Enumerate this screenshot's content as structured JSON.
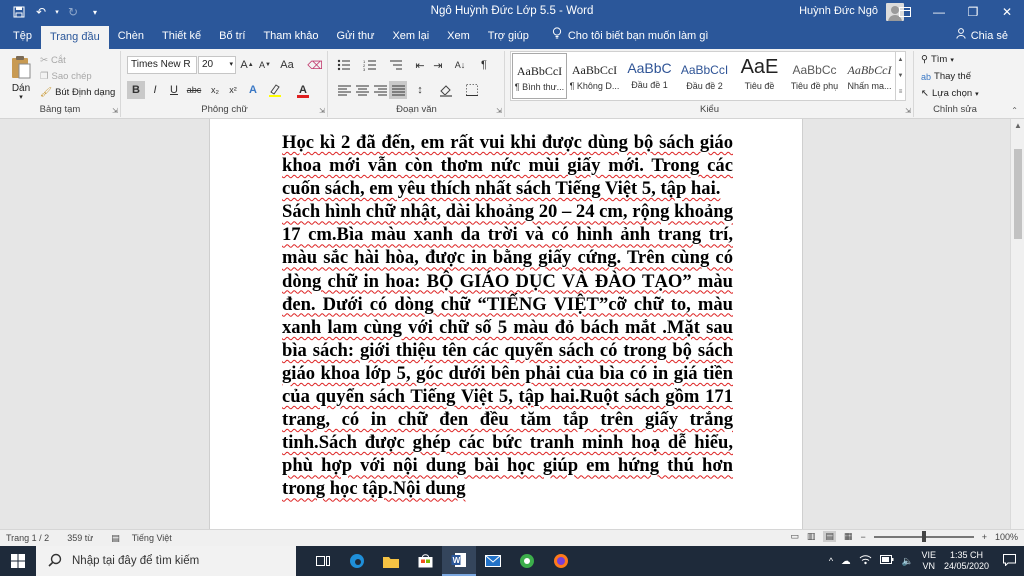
{
  "window": {
    "title": "Ngô Huỳnh Đức Lớp 5.5  -  Word",
    "user_name": "Huỳnh Đức Ngô",
    "minimize": "—",
    "restore": "❐",
    "close": "✕"
  },
  "tabs": [
    "Tệp",
    "Trang đầu",
    "Chèn",
    "Thiết kế",
    "Bố trí",
    "Tham khảo",
    "Gửi thư",
    "Xem lại",
    "Xem",
    "Trợ giúp"
  ],
  "tell_me": "Cho tôi biết bạn muốn làm gì",
  "share": "Chia sẻ",
  "clipboard": {
    "paste": "Dán",
    "cut": "Cắt",
    "copy": "Sao chép",
    "format_painter": "Bút Định dạng",
    "label": "Bảng tạm"
  },
  "font": {
    "name": "Times New R",
    "size": "20",
    "label": "Phông chữ",
    "bold": "B",
    "italic": "I",
    "underline": "U",
    "strike": "abc",
    "sub": "x₂",
    "sup": "x²",
    "grow": "A",
    "shrink": "A",
    "case": "Aa",
    "color_a": "A"
  },
  "paragraph": {
    "label": "Đoạn văn"
  },
  "styles": {
    "label": "Kiểu",
    "items": [
      {
        "sample": "AaBbCcI",
        "name": "¶ Bình thư..."
      },
      {
        "sample": "AaBbCcI",
        "name": "¶ Không D..."
      },
      {
        "sample": "AaBbC",
        "name": "Đầu đề 1"
      },
      {
        "sample": "AaBbCcI",
        "name": "Đầu đề 2"
      },
      {
        "sample": "AaE",
        "name": "Tiêu đề"
      },
      {
        "sample": "AaBbCc",
        "name": "Tiêu đề phụ"
      },
      {
        "sample": "AaBbCcI",
        "name": "Nhấn ma..."
      }
    ]
  },
  "editing": {
    "find": "Tìm",
    "replace": "Thay thế",
    "select": "Lựa chọn",
    "label": "Chỉnh sửa"
  },
  "document": {
    "p1": "Học kì 2 đã đến, em rất vui khi được dùng bộ sách giáo khoa mới vẫn còn thơm nức mùi giấy mới. Trong các cuốn sách, em yêu thích nhất sách Tiếng Việt 5, tập hai.",
    "p2": "Sách hình chữ nhật, dài khoảng 20 – 24 cm, rộng khoảng 17 cm.Bìa màu xanh da trời và có hình ảnh trang trí, màu sắc hài hòa, được in bằng giấy cứng. Trên cùng có dòng chữ in hoa: BỘ GIÁO DỤC VÀ ĐÀO TẠO” màu đen. Dưới có dòng chữ “TIẾNG VIỆT”cỡ chữ to, màu xanh lam cùng với chữ số 5 màu đỏ bách mắt .Mặt sau bìa sách: giới thiệu tên các quyển sách có trong bộ sách giáo khoa lớp 5, góc dưới bên phải của bìa có in giá tiền của quyển sách Tiếng Việt 5, tập hai.Ruột sách gồm 171 trang, có in chữ đen đều tăm tắp trên giấy trắng tinh.Sách được ghép các bức tranh minh hoạ dễ hiểu, phù hợp với nội dung bài học giúp em hứng thú hơn trong học tập.Nội dung"
  },
  "status": {
    "page": "Trang 1 / 2",
    "words": "359 từ",
    "language": "Tiếng Việt",
    "zoom": "100%",
    "zoom_fraction": 0.5
  },
  "taskbar": {
    "search_placeholder": "Nhập tại đây để tìm kiếm",
    "lang_top": "VIE",
    "lang_bottom": "VN",
    "time": "1:35 CH",
    "date": "24/05/2020"
  }
}
